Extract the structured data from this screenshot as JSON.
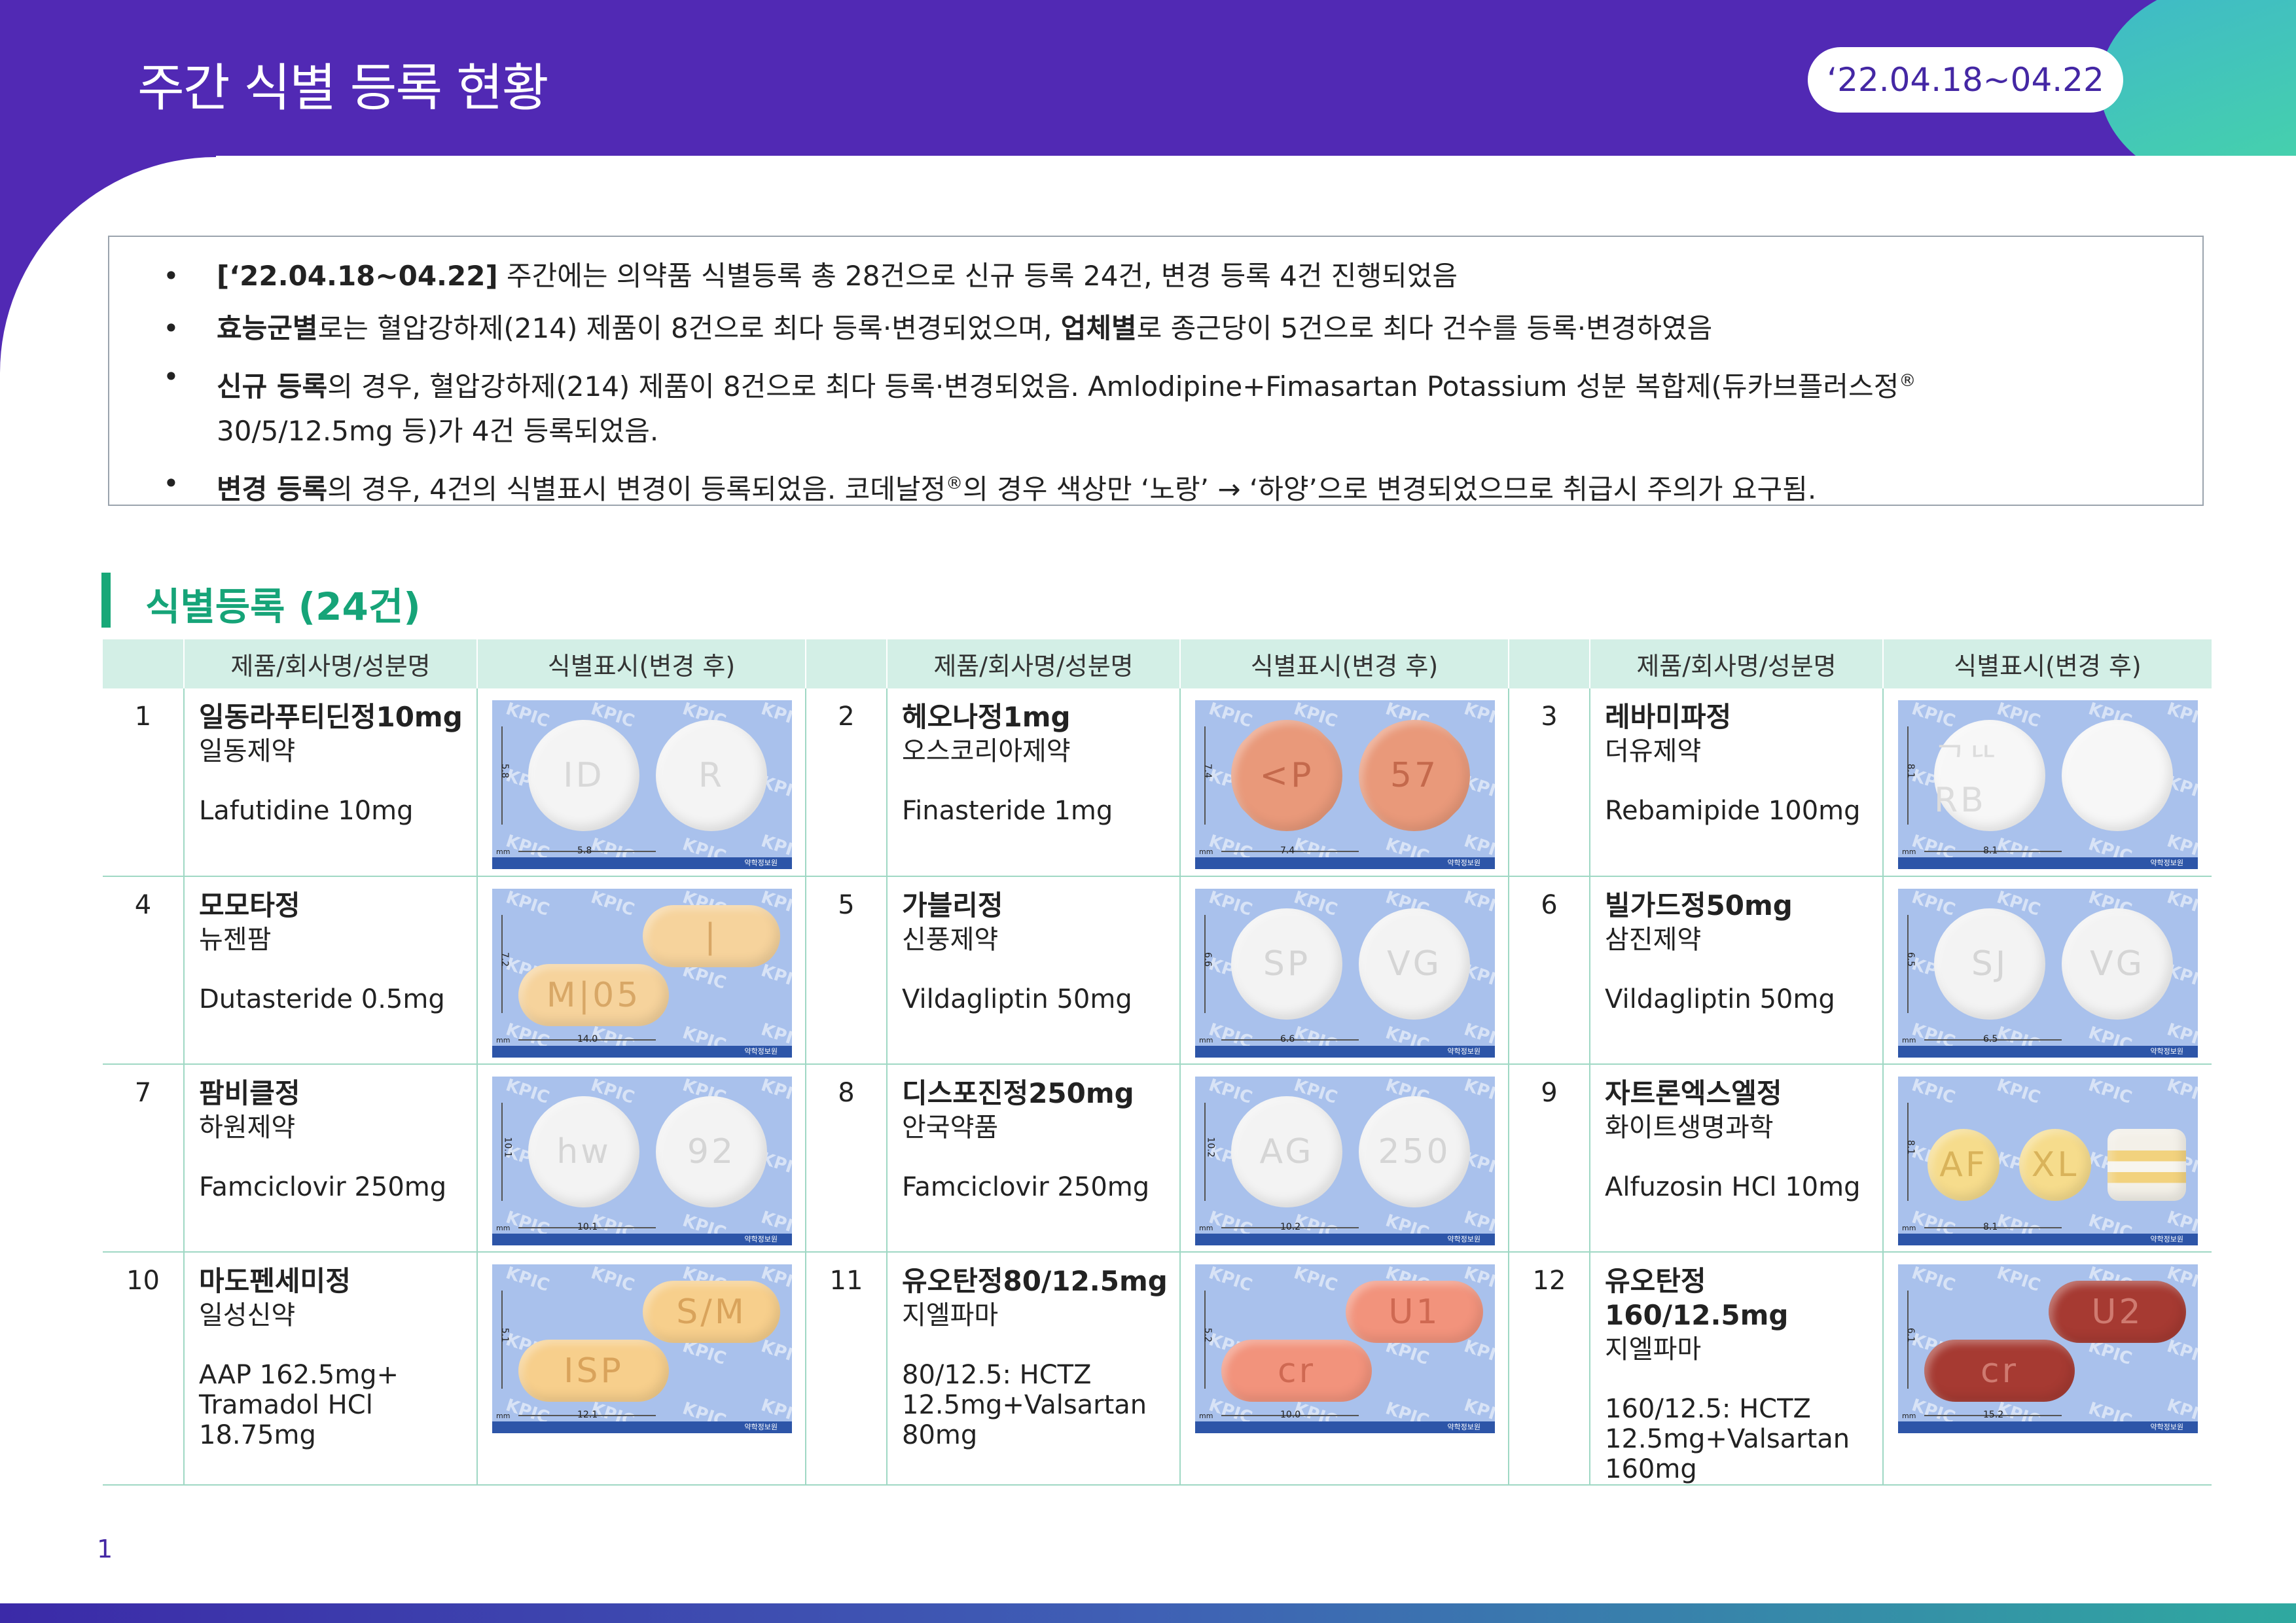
{
  "header": {
    "title": "주간 식별 등록 현황",
    "date_range": "‘22.04.18~04.22"
  },
  "summary": {
    "b1_bold": "[‘22.04.18~04.22]",
    "b1_rest": " 주간에는 의약품 식별등록 총 28건으로 신규 등록 24건, 변경 등록 4건 진행되었음",
    "b2_bold1": "효능군별",
    "b2_mid": "로는 혈압강하제(214) 제품이 8건으로 최다 등록·변경되었으며, ",
    "b2_bold2": "업체별",
    "b2_rest": "로 종근당이 5건으로 최다 건수를 등록·변경하였음",
    "b3_bold": "신규 등록",
    "b3_line1": "의 경우, 혈압강하제(214) 제품이 8건으로 최다 등록·변경되었음. Amlodipine+Fimasartan Potassium 성분 복합제(듀카브플러스정",
    "b3_reg": "®",
    "b3_line2": "30/5/12.5mg 등)가 4건 등록되었음.",
    "b4_bold": "변경 등록",
    "b4_part1": "의 경우, 4건의 식별표시 변경이 등록되었음. 코데날정",
    "b4_reg": "®",
    "b4_part2": "의 경우 색상만 ‘노랑’ → ‘하양’으로 변경되었으므로 취급시 주의가 요구됨."
  },
  "section": {
    "title": "식별등록 (24건)"
  },
  "table": {
    "headers": [
      "제품/회사명/성분명",
      "식별표시(변경 후)"
    ],
    "items": [
      {
        "no": "1",
        "name": "일동라푸티딘정10mg",
        "company": "일동제약",
        "ingredient": "Lafutidine 10mg",
        "size_x": "5.8",
        "size_y": "5.8",
        "marks": [
          "ID",
          "R"
        ],
        "color": "#f4f4f4",
        "text_color": "#d8d8d8",
        "shape": "round"
      },
      {
        "no": "2",
        "name": "헤오나정1mg",
        "company": "오스코리아제약",
        "ingredient": "Finasteride 1mg",
        "size_x": "7.4",
        "size_y": "7.4",
        "marks": [
          "<P",
          "57"
        ],
        "color": "#e9997a",
        "text_color": "#c4694c",
        "shape": "octa"
      },
      {
        "no": "3",
        "name": "레바미파정",
        "company": "더유제약",
        "ingredient": "Rebamipide 100mg",
        "size_x": "8.1",
        "size_y": "8.1",
        "marks": [
          "ᄀᄔ RB",
          ""
        ],
        "color": "#f7f7f7",
        "text_color": "#dcdcdc",
        "shape": "round"
      },
      {
        "no": "4",
        "name": "모모타정",
        "company": "뉴젠팜",
        "ingredient": "Dutasteride 0.5mg",
        "size_x": "14.0",
        "size_y": "7.2",
        "marks": [
          "M|05",
          "|"
        ],
        "color": "#f6d39c",
        "text_color": "#d8a766",
        "shape": "oval"
      },
      {
        "no": "5",
        "name": "가블리정",
        "company": "신풍제약",
        "ingredient": "Vildagliptin 50mg",
        "size_x": "6.6",
        "size_y": "6.6",
        "marks": [
          "SP",
          "VG"
        ],
        "color": "#f3f3f3",
        "text_color": "#d5d5d5",
        "shape": "round"
      },
      {
        "no": "6",
        "name": "빌가드정50mg",
        "company": "삼진제약",
        "ingredient": "Vildagliptin 50mg",
        "size_x": "6.5",
        "size_y": "6.5",
        "marks": [
          "SJ",
          "VG"
        ],
        "color": "#f3f3f3",
        "text_color": "#d5d5d5",
        "shape": "round"
      },
      {
        "no": "7",
        "name": "팜비클정",
        "company": "하원제약",
        "ingredient": "Famciclovir 250mg",
        "size_x": "10.1",
        "size_y": "10.1",
        "marks": [
          "hw",
          "92"
        ],
        "color": "#f3f3f3",
        "text_color": "#d5d5d5",
        "shape": "round"
      },
      {
        "no": "8",
        "name": "디스포진정250mg",
        "company": "안국약품",
        "ingredient": "Famciclovir 250mg",
        "size_x": "10.2",
        "size_y": "10.2",
        "marks": [
          "AG",
          "250"
        ],
        "color": "#f3f3f3",
        "text_color": "#d5d5d5",
        "shape": "round"
      },
      {
        "no": "9",
        "name": "자트론엑스엘정",
        "company": "화이트생명과학",
        "ingredient": "Alfuzosin HCl 10mg",
        "size_x": "8.1",
        "size_y": "8.1",
        "marks": [
          "AF",
          "XL"
        ],
        "color": "#f6dc8c",
        "text_color": "#d9b35a",
        "shape": "round"
      },
      {
        "no": "10",
        "name": "마도펜세미정",
        "company": "일성신약",
        "ingredient": "AAP 162.5mg+ Tramadol HCl 18.75mg",
        "size_x": "12.1",
        "size_y": "5.1",
        "marks": [
          "ISP",
          "S/M"
        ],
        "color": "#f7cf8c",
        "text_color": "#d9a35b",
        "shape": "oval"
      },
      {
        "no": "11",
        "name": "유오탄정80/12.5mg",
        "company": "지엘파마",
        "ingredient": "80/12.5: HCTZ 12.5mg+Valsartan 80mg",
        "size_x": "10.0",
        "size_y": "5.2",
        "marks": [
          "cr",
          "U1"
        ],
        "color": "#f2937c",
        "text_color": "#cf6952",
        "shape": "oval"
      },
      {
        "no": "12",
        "name": "유오탄정160/12.5mg",
        "company": "지엘파마",
        "ingredient": "160/12.5: HCTZ 12.5mg+Valsartan 160mg",
        "size_x": "15.2",
        "size_y": "6.1",
        "marks": [
          "cr",
          "U2"
        ],
        "color": "#a63a32",
        "text_color": "#cf7a70",
        "shape": "oval"
      }
    ]
  },
  "page_number": "1",
  "watermark": "KPIC",
  "image_footer": "약학정보원",
  "scale_unit": "mm"
}
